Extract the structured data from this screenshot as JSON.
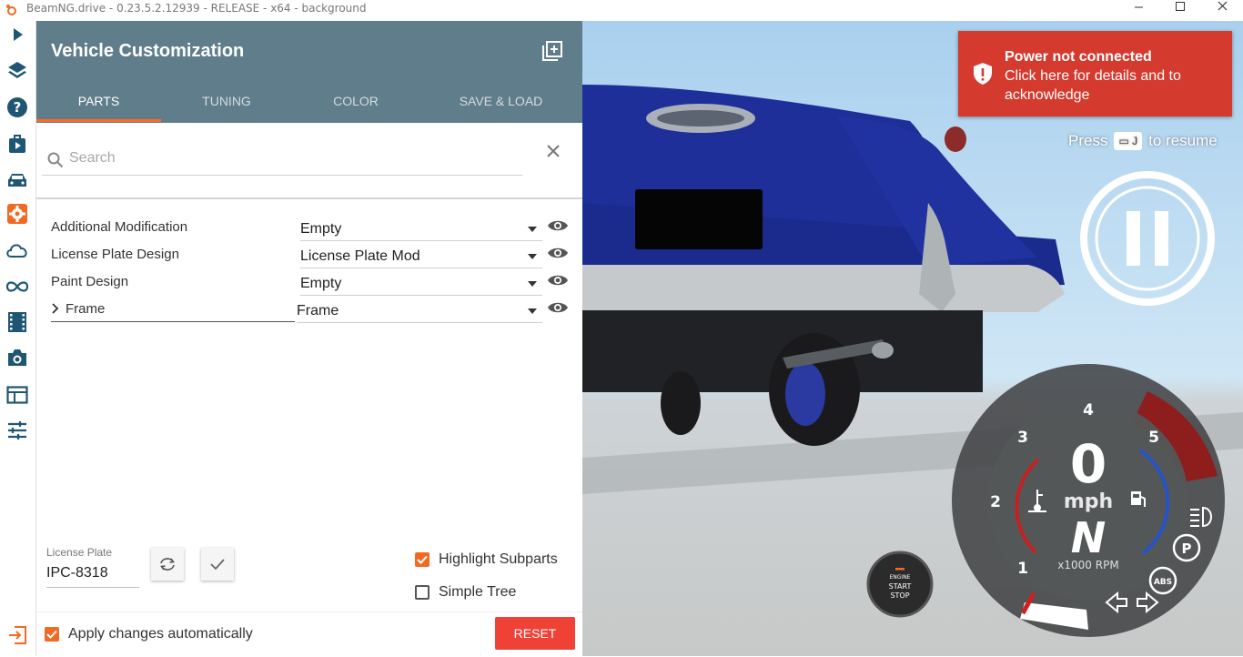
{
  "window": {
    "title": "BeamNG.drive - 0.23.5.2.12939 - RELEASE - x64 - background",
    "controls": [
      "minimize-icon",
      "maximize-icon",
      "close-icon"
    ]
  },
  "rail": {
    "items": [
      "play-icon",
      "layers-icon",
      "help-icon",
      "scenarios-icon",
      "vehicles-icon",
      "vehicle-config-icon",
      "cloud-icon",
      "infinity-icon",
      "film-icon",
      "camera-icon",
      "app-layout-icon",
      "options-icon"
    ],
    "bottom": "exit-icon"
  },
  "panel": {
    "title": "Vehicle Customization",
    "tabs": [
      "PARTS",
      "TUNING",
      "COLOR",
      "SAVE & LOAD"
    ],
    "active_tab": "PARTS",
    "search": {
      "placeholder": "Search",
      "value": ""
    },
    "parts": [
      {
        "label": "Additional Modification",
        "value": "Empty"
      },
      {
        "label": "License Plate Design",
        "value": "License Plate Mod"
      },
      {
        "label": "Paint Design",
        "value": "Empty"
      },
      {
        "label": "Frame",
        "value": "Frame",
        "expandable": true
      }
    ],
    "license_plate": {
      "label": "License Plate",
      "value": "IPC-8318"
    },
    "highlight_subparts": {
      "label": "Highlight Subparts",
      "checked": true
    },
    "simple_tree": {
      "label": "Simple Tree",
      "checked": false
    },
    "apply_auto": {
      "label": "Apply changes automatically",
      "checked": true
    },
    "reset_label": "RESET"
  },
  "alert": {
    "title": "Power not connected",
    "line2": "Click here for details and to",
    "line3": "acknowledge"
  },
  "resume": {
    "prefix": "Press",
    "key": "J",
    "suffix": "to resume"
  },
  "dash": {
    "speed": "0",
    "unit": "mph",
    "gear": "N",
    "rpm_unit": "x1000 RPM",
    "ticks": [
      "1",
      "2",
      "3",
      "4",
      "5"
    ],
    "engine_button": [
      "ENGINE",
      "START",
      "STOP"
    ],
    "parking_label": "P",
    "abs_label": "ABS"
  }
}
